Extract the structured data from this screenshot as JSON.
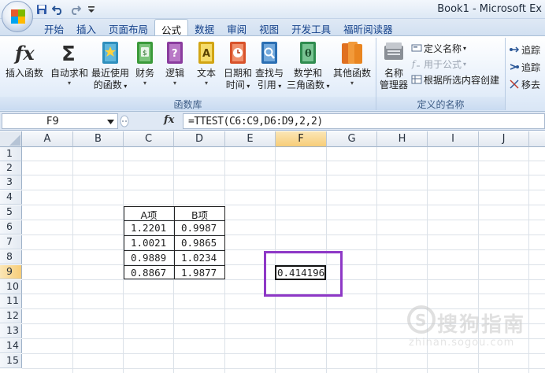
{
  "window": {
    "title": "Book1 - Microsoft Ex",
    "quick_access": [
      "save-icon",
      "undo-icon",
      "redo-icon",
      "customize-icon"
    ]
  },
  "tabs": [
    {
      "label": "开始",
      "active": false
    },
    {
      "label": "插入",
      "active": false
    },
    {
      "label": "页面布局",
      "active": false
    },
    {
      "label": "公式",
      "active": true
    },
    {
      "label": "数据",
      "active": false
    },
    {
      "label": "审阅",
      "active": false
    },
    {
      "label": "视图",
      "active": false
    },
    {
      "label": "开发工具",
      "active": false
    },
    {
      "label": "福昕阅读器",
      "active": false
    }
  ],
  "ribbon": {
    "function_library": {
      "group_label": "函数库",
      "insert_function": "插入函数",
      "autosum": "自动求和",
      "recent_line1": "最近使用",
      "recent_line2": "的函数",
      "financial": "财务",
      "logical": "逻辑",
      "text": "文本",
      "datetime_line1": "日期和",
      "datetime_line2": "时间",
      "lookup_line1": "查找与",
      "lookup_line2": "引用",
      "math_line1": "数学和",
      "math_line2": "三角函数",
      "more": "其他函数"
    },
    "defined_names": {
      "group_label": "定义的名称",
      "name_manager_line1": "名称",
      "name_manager_line2": "管理器",
      "define_name": "定义名称",
      "use_in_formula": "用于公式",
      "create_from_selection": "根据所选内容创建"
    },
    "formula_auditing": {
      "trace_precedents": "追踪",
      "trace_dependents": "追踪",
      "remove_arrows": "移去"
    }
  },
  "formula_bar": {
    "name_box": "F9",
    "fx_label": "fx",
    "formula": "=TTEST(C6:C9,D6:D9,2,2)"
  },
  "sheet": {
    "columns": [
      "A",
      "B",
      "C",
      "D",
      "E",
      "F",
      "G",
      "H",
      "I",
      "J"
    ],
    "rows": [
      "1",
      "2",
      "3",
      "4",
      "5",
      "6",
      "7",
      "8",
      "9",
      "10",
      "11",
      "12",
      "13",
      "14",
      "15"
    ],
    "selected_cell": "F9",
    "table": {
      "headers": [
        "A项",
        "B项"
      ],
      "rows": [
        [
          "1.2201",
          "0.9987"
        ],
        [
          "1.0021",
          "0.9865"
        ],
        [
          "0.9889",
          "1.0234"
        ],
        [
          "0.8867",
          "1.9877"
        ]
      ]
    },
    "result_value": "0.414196",
    "highlight_color": "#8e38c6"
  },
  "watermark": {
    "text": "搜狗指南",
    "url": "zhinan.sogou.com"
  }
}
